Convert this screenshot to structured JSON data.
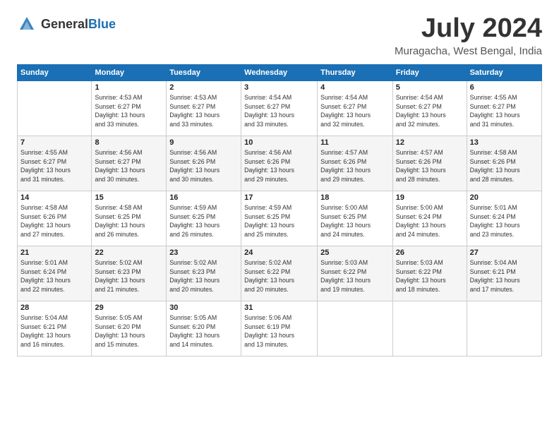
{
  "header": {
    "logo_general": "General",
    "logo_blue": "Blue",
    "month_year": "July 2024",
    "location": "Muragacha, West Bengal, India"
  },
  "days_of_week": [
    "Sunday",
    "Monday",
    "Tuesday",
    "Wednesday",
    "Thursday",
    "Friday",
    "Saturday"
  ],
  "weeks": [
    [
      {
        "day": "",
        "info": ""
      },
      {
        "day": "1",
        "info": "Sunrise: 4:53 AM\nSunset: 6:27 PM\nDaylight: 13 hours\nand 33 minutes."
      },
      {
        "day": "2",
        "info": "Sunrise: 4:53 AM\nSunset: 6:27 PM\nDaylight: 13 hours\nand 33 minutes."
      },
      {
        "day": "3",
        "info": "Sunrise: 4:54 AM\nSunset: 6:27 PM\nDaylight: 13 hours\nand 33 minutes."
      },
      {
        "day": "4",
        "info": "Sunrise: 4:54 AM\nSunset: 6:27 PM\nDaylight: 13 hours\nand 32 minutes."
      },
      {
        "day": "5",
        "info": "Sunrise: 4:54 AM\nSunset: 6:27 PM\nDaylight: 13 hours\nand 32 minutes."
      },
      {
        "day": "6",
        "info": "Sunrise: 4:55 AM\nSunset: 6:27 PM\nDaylight: 13 hours\nand 31 minutes."
      }
    ],
    [
      {
        "day": "7",
        "info": "Sunrise: 4:55 AM\nSunset: 6:27 PM\nDaylight: 13 hours\nand 31 minutes."
      },
      {
        "day": "8",
        "info": "Sunrise: 4:56 AM\nSunset: 6:27 PM\nDaylight: 13 hours\nand 30 minutes."
      },
      {
        "day": "9",
        "info": "Sunrise: 4:56 AM\nSunset: 6:26 PM\nDaylight: 13 hours\nand 30 minutes."
      },
      {
        "day": "10",
        "info": "Sunrise: 4:56 AM\nSunset: 6:26 PM\nDaylight: 13 hours\nand 29 minutes."
      },
      {
        "day": "11",
        "info": "Sunrise: 4:57 AM\nSunset: 6:26 PM\nDaylight: 13 hours\nand 29 minutes."
      },
      {
        "day": "12",
        "info": "Sunrise: 4:57 AM\nSunset: 6:26 PM\nDaylight: 13 hours\nand 28 minutes."
      },
      {
        "day": "13",
        "info": "Sunrise: 4:58 AM\nSunset: 6:26 PM\nDaylight: 13 hours\nand 28 minutes."
      }
    ],
    [
      {
        "day": "14",
        "info": "Sunrise: 4:58 AM\nSunset: 6:26 PM\nDaylight: 13 hours\nand 27 minutes."
      },
      {
        "day": "15",
        "info": "Sunrise: 4:58 AM\nSunset: 6:25 PM\nDaylight: 13 hours\nand 26 minutes."
      },
      {
        "day": "16",
        "info": "Sunrise: 4:59 AM\nSunset: 6:25 PM\nDaylight: 13 hours\nand 26 minutes."
      },
      {
        "day": "17",
        "info": "Sunrise: 4:59 AM\nSunset: 6:25 PM\nDaylight: 13 hours\nand 25 minutes."
      },
      {
        "day": "18",
        "info": "Sunrise: 5:00 AM\nSunset: 6:25 PM\nDaylight: 13 hours\nand 24 minutes."
      },
      {
        "day": "19",
        "info": "Sunrise: 5:00 AM\nSunset: 6:24 PM\nDaylight: 13 hours\nand 24 minutes."
      },
      {
        "day": "20",
        "info": "Sunrise: 5:01 AM\nSunset: 6:24 PM\nDaylight: 13 hours\nand 23 minutes."
      }
    ],
    [
      {
        "day": "21",
        "info": "Sunrise: 5:01 AM\nSunset: 6:24 PM\nDaylight: 13 hours\nand 22 minutes."
      },
      {
        "day": "22",
        "info": "Sunrise: 5:02 AM\nSunset: 6:23 PM\nDaylight: 13 hours\nand 21 minutes."
      },
      {
        "day": "23",
        "info": "Sunrise: 5:02 AM\nSunset: 6:23 PM\nDaylight: 13 hours\nand 20 minutes."
      },
      {
        "day": "24",
        "info": "Sunrise: 5:02 AM\nSunset: 6:22 PM\nDaylight: 13 hours\nand 20 minutes."
      },
      {
        "day": "25",
        "info": "Sunrise: 5:03 AM\nSunset: 6:22 PM\nDaylight: 13 hours\nand 19 minutes."
      },
      {
        "day": "26",
        "info": "Sunrise: 5:03 AM\nSunset: 6:22 PM\nDaylight: 13 hours\nand 18 minutes."
      },
      {
        "day": "27",
        "info": "Sunrise: 5:04 AM\nSunset: 6:21 PM\nDaylight: 13 hours\nand 17 minutes."
      }
    ],
    [
      {
        "day": "28",
        "info": "Sunrise: 5:04 AM\nSunset: 6:21 PM\nDaylight: 13 hours\nand 16 minutes."
      },
      {
        "day": "29",
        "info": "Sunrise: 5:05 AM\nSunset: 6:20 PM\nDaylight: 13 hours\nand 15 minutes."
      },
      {
        "day": "30",
        "info": "Sunrise: 5:05 AM\nSunset: 6:20 PM\nDaylight: 13 hours\nand 14 minutes."
      },
      {
        "day": "31",
        "info": "Sunrise: 5:06 AM\nSunset: 6:19 PM\nDaylight: 13 hours\nand 13 minutes."
      },
      {
        "day": "",
        "info": ""
      },
      {
        "day": "",
        "info": ""
      },
      {
        "day": "",
        "info": ""
      }
    ]
  ]
}
